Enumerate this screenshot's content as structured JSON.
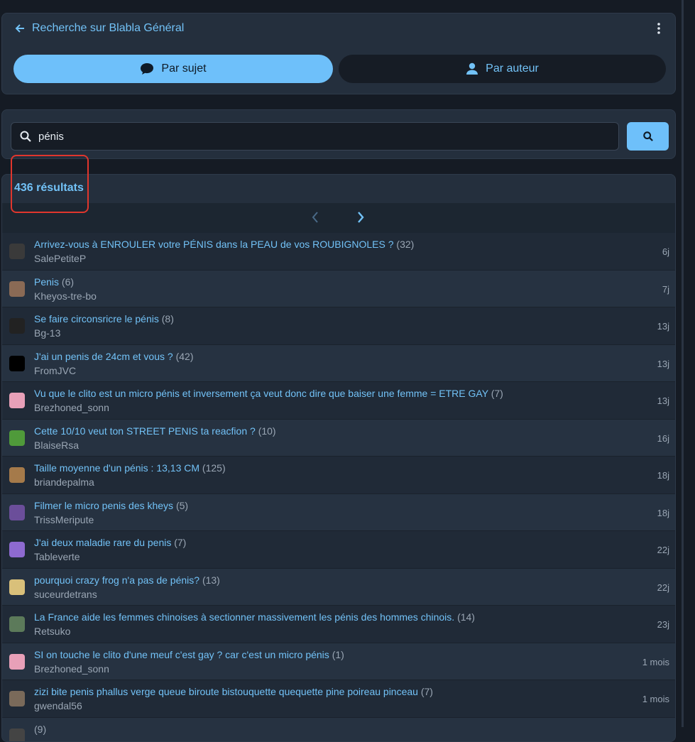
{
  "header": {
    "title": "Recherche sur Blabla Général",
    "tab_subject": "Par sujet",
    "tab_author": "Par auteur"
  },
  "search": {
    "value": "pénis"
  },
  "results": {
    "count_label": "436 résultats"
  },
  "topics": [
    {
      "title": "Arrivez-vous à ENROULER votre PÉNIS dans la PEAU de vos ROUBIGNOLES ?",
      "count": "(32)",
      "author": "SalePetiteP",
      "age": "6j",
      "avatar_color": "#3a3a3a"
    },
    {
      "title": "Penis",
      "count": "(6)",
      "author": "Kheyos-tre-bo",
      "age": "7j",
      "avatar_color": "#8a6a55"
    },
    {
      "title": "Se faire circonsricre le pénis",
      "count": "(8)",
      "author": "Bg-13",
      "age": "13j",
      "avatar_color": "#222222"
    },
    {
      "title": "J'ai un penis de 24cm et vous ?",
      "count": "(42)",
      "author": "FromJVC",
      "age": "13j",
      "avatar_color": "#000000"
    },
    {
      "title": "Vu que le clito est un micro pénis et inversement ça veut donc dire que baiser une femme = ETRE GAY",
      "count": "(7)",
      "author": "Brezhoned_sonn",
      "age": "13j",
      "avatar_color": "#e8a0b8"
    },
    {
      "title": "Cette 10/10 veut ton STREET PENIS ta reacfion ?",
      "count": "(10)",
      "author": "BlaiseRsa",
      "age": "16j",
      "avatar_color": "#4f9a3a"
    },
    {
      "title": "Taille moyenne d'un pénis : 13,13 CM",
      "count": "(125)",
      "author": "briandepalma",
      "age": "18j",
      "avatar_color": "#a57a4a"
    },
    {
      "title": "Filmer le micro penis des kheys",
      "count": "(5)",
      "author": "TrissMeripute",
      "age": "18j",
      "avatar_color": "#6b4e9a"
    },
    {
      "title": "J'ai deux maladie rare du penis",
      "count": "(7)",
      "author": "Tableverte",
      "age": "22j",
      "avatar_color": "#8e6ad0"
    },
    {
      "title": "pourquoi crazy frog n'a pas de pénis?",
      "count": "(13)",
      "author": "suceurdetrans",
      "age": "22j",
      "avatar_color": "#d9c07a"
    },
    {
      "title": "La France aide les femmes chinoises à sectionner massivement les pénis des hommes chinois.",
      "count": "(14)",
      "author": "Retsuko",
      "age": "23j",
      "avatar_color": "#5c7a5a"
    },
    {
      "title": "SI on touche le clito d'une meuf c'est gay ? car c'est un micro pénis",
      "count": "(1)",
      "author": "Brezhoned_sonn",
      "age": "1 mois",
      "avatar_color": "#e8a0b8"
    },
    {
      "title": "zizi bite penis phallus verge queue biroute bistouquette quequette pine poireau pinceau",
      "count": "(7)",
      "author": "gwendal56",
      "age": "1 mois",
      "avatar_color": "#7a6a5a"
    },
    {
      "title": "",
      "count": "(9)",
      "author": "",
      "age": "",
      "avatar_color": "#444444"
    }
  ]
}
